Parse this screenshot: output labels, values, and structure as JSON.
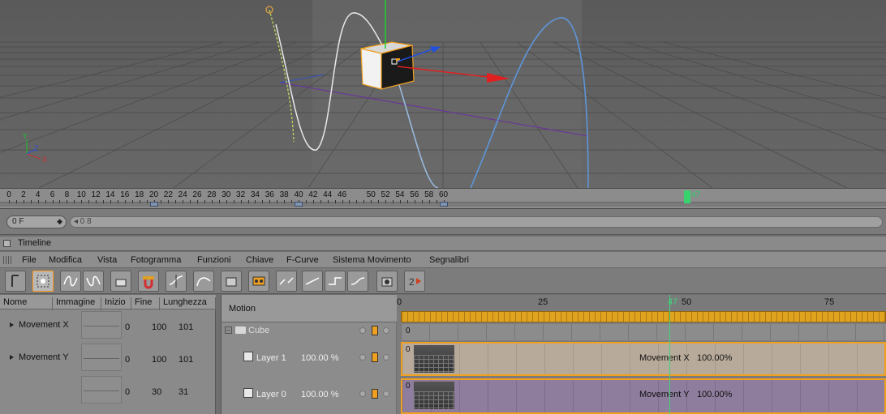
{
  "viewport": {
    "axis_labels": {
      "y": "Y",
      "z": "Z",
      "x": "X"
    }
  },
  "ruler": {
    "ticks": [
      "0",
      "2",
      "4",
      "6",
      "8",
      "10",
      "12",
      "14",
      "16",
      "18",
      "20",
      "22",
      "24",
      "26",
      "28",
      "30",
      "32",
      "34",
      "36",
      "38",
      "40",
      "42",
      "44",
      "46",
      "47",
      "50",
      "52",
      "54",
      "56",
      "58",
      "60"
    ],
    "current_frame_label": "47",
    "keyframes": [
      20,
      40,
      60
    ]
  },
  "framebar": {
    "current_frame": "0 F",
    "slider_value": "◂ 0 8"
  },
  "panel": {
    "title": "Timeline"
  },
  "menu": [
    "File",
    "Modifica",
    "Vista",
    "Fotogramma",
    "Funzioni",
    "Chiave",
    "F-Curve",
    "Sistema Movimento",
    "Segnalibri"
  ],
  "toolbar": {
    "icons": [
      "pointer-icon",
      "select-box-icon",
      "curve-wave-icon",
      "curve-wave-alt-icon",
      "keyframe-icon",
      "magnet-snap-icon",
      "curve-tangent-icon",
      "ease-curve-icon",
      "record-icon",
      "film-icon",
      "link-break-icon",
      "linear-interp-icon",
      "step-interp-icon",
      "soft-interp-icon",
      "camera-key-icon",
      "layer-2-icon"
    ]
  },
  "attributes": {
    "headers": [
      "Nome",
      "Immagine",
      "Inizio",
      "Fine",
      "Lunghezza"
    ],
    "rows": [
      {
        "name": "Movement X",
        "start": "0",
        "end": "100",
        "length": "101"
      },
      {
        "name": "Movement Y",
        "start": "0",
        "end": "100",
        "length": "101"
      },
      {
        "name": "",
        "start": "0",
        "end": "30",
        "length": "31"
      }
    ]
  },
  "motion": {
    "header": "Motion",
    "object": "Cube",
    "layers": [
      {
        "name": "Layer 1",
        "strength": "100.00 %"
      },
      {
        "name": "Layer 0",
        "strength": "100.00 %"
      }
    ]
  },
  "tracks": {
    "ruler": [
      "0",
      "25",
      "50",
      "75"
    ],
    "playhead_label": "47",
    "cube_row_start": "0",
    "clips": [
      {
        "start": "0",
        "label": "Movement X",
        "strength": "100.00%",
        "color": "#b7aa9a"
      },
      {
        "start": "0",
        "label": "Movement Y",
        "strength": "100.00%",
        "color": "#8e7d9c"
      }
    ]
  },
  "colors": {
    "accent_orange": "#f0a020",
    "playhead_green": "#39d36e",
    "viewport_bg": "#5e5e5e"
  }
}
